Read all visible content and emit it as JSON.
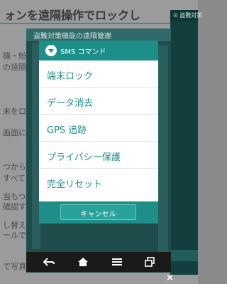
{
  "background": {
    "title": "ォンを遠隔操作でロックし",
    "section_title": "盗難対策機能の遠隔管理",
    "lines": [
      "機・紛失",
      "の遠隔ロ",
      "末をロッ",
      "画面に表示",
      "つからな",
      "すべての",
      "当もつか",
      "確認する",
      "し替えら",
      "ールで送",
      "で写真撮"
    ]
  },
  "side_panel": {
    "header": "⊙ 盗難対策"
  },
  "dialog": {
    "title": "SMS コマンド",
    "items": [
      {
        "label": "端末ロック"
      },
      {
        "label": "データ消去"
      },
      {
        "label": "GPS 追跡"
      },
      {
        "label": "プライバシー保護"
      },
      {
        "label": "完全リセット"
      }
    ],
    "cancel_label": "キャンセル"
  },
  "navbar": {
    "icons": [
      "back-icon",
      "home-icon",
      "menu-icon",
      "recent-apps-icon"
    ]
  },
  "close_label": "×",
  "colors": {
    "accent": "#1e8e89",
    "frame": "#1f4d4b",
    "navbar": "#1a1a1a"
  }
}
